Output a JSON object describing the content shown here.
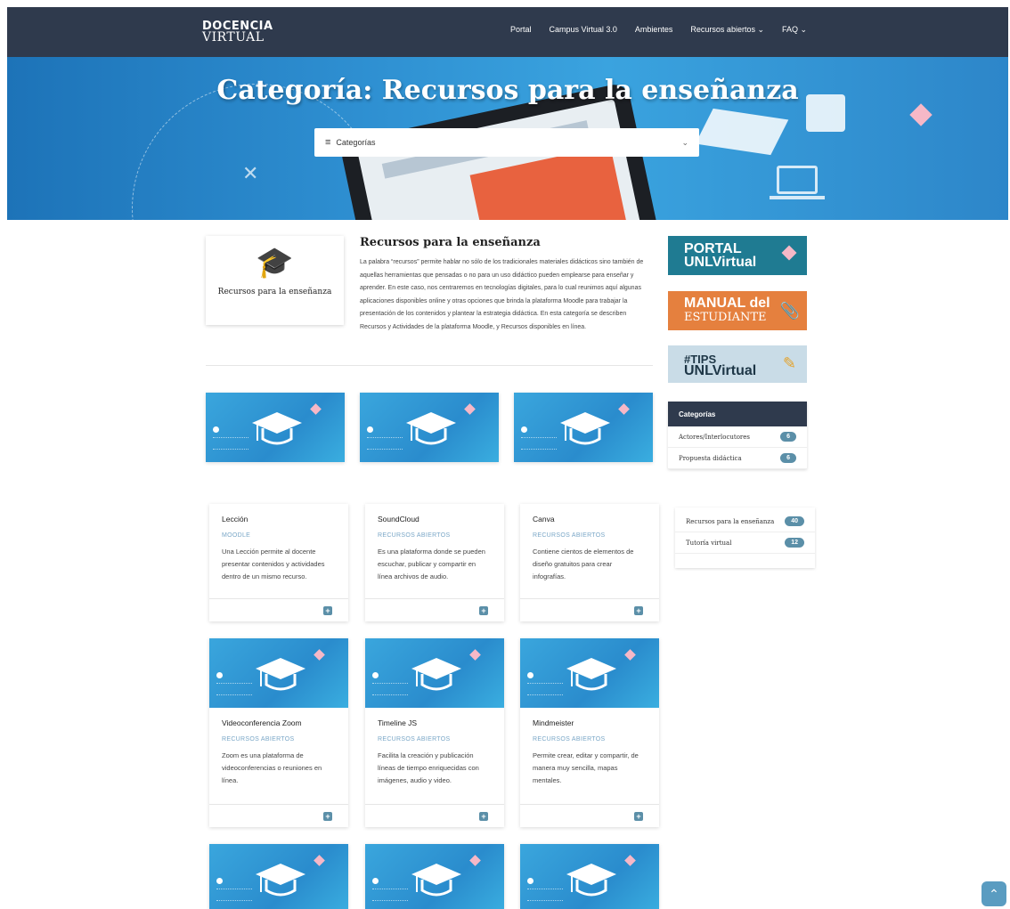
{
  "header": {
    "logo_line1": "DOCENCIA",
    "logo_line2": "VIRTUAL",
    "nav": [
      "Portal",
      "Campus Virtual 3.0",
      "Ambientes",
      "Recursos abiertos ⌄",
      "FAQ ⌄"
    ]
  },
  "hero": {
    "title": "Categoría: Recursos para la enseñanza",
    "select_label": "Categorías"
  },
  "intro": {
    "card_label": "Recursos para la enseñanza",
    "title": "Recursos para la enseñanza",
    "description": "La palabra “recursos” permite hablar no sólo de los tradicionales materiales didácticos sino también de aquellas herramientas que pensadas o no para un uso didáctico pueden emplearse para enseñar y aprender. En este caso, nos centraremos en tecnologías digitales, para lo cual reunimos aquí algunas aplicaciones disponibles online y otras opciones que brinda la plataforma Moodle para trabajar la presentación de los contenidos y plantear la estrategia didáctica. En esta categoría se describen Recursos y Actividades de la plataforma Moodle, y Recursos disponibles en línea."
  },
  "banners": {
    "portal": [
      "PORTAL",
      "UNLVirtual"
    ],
    "manual": [
      "MANUAL del",
      "ESTUDIANTE"
    ],
    "tips": [
      "#TIPS",
      "UNLVirtual"
    ]
  },
  "sidebar": {
    "title": "Categorías",
    "items_top": [
      {
        "label": "Actores/Interlocutores",
        "count": "6"
      },
      {
        "label": "Propuesta didáctica",
        "count": "6"
      }
    ],
    "items_bottom": [
      {
        "label": "Recursos para la enseñanza",
        "count": "40"
      },
      {
        "label": "Tutoría virtual",
        "count": "12"
      }
    ]
  },
  "cards": [
    {
      "name": "Lección",
      "tag": "MOODLE",
      "desc": "Una Lección permite al docente presentar contenidos y actividades dentro de un mismo recurso."
    },
    {
      "name": "SoundCloud",
      "tag": "RECURSOS ABIERTOS",
      "desc": "Es una plataforma donde se pueden escuchar, publicar y compartir en línea archivos de audio."
    },
    {
      "name": "Canva",
      "tag": "RECURSOS ABIERTOS",
      "desc": "Contiene cientos de elementos de diseño gratuitos para crear infografías."
    },
    {
      "name": "Videoconferencia Zoom",
      "tag": "RECURSOS ABIERTOS",
      "desc": "Zoom es una plataforma de videoconferencias o reuniones en línea."
    },
    {
      "name": "Timeline JS",
      "tag": "RECURSOS ABIERTOS",
      "desc": "Facilita la creación y publicación líneas de tiempo enriquecidas con imágenes, audio y video."
    },
    {
      "name": "Mindmeister",
      "tag": "RECURSOS ABIERTOS",
      "desc": "Permite crear, editar y compartir, de manera muy sencilla, mapas mentales."
    }
  ],
  "colors": {
    "header_bg": "#2f3a4d",
    "accent": "#5b8fa8",
    "tag": "#7aa7c7"
  }
}
